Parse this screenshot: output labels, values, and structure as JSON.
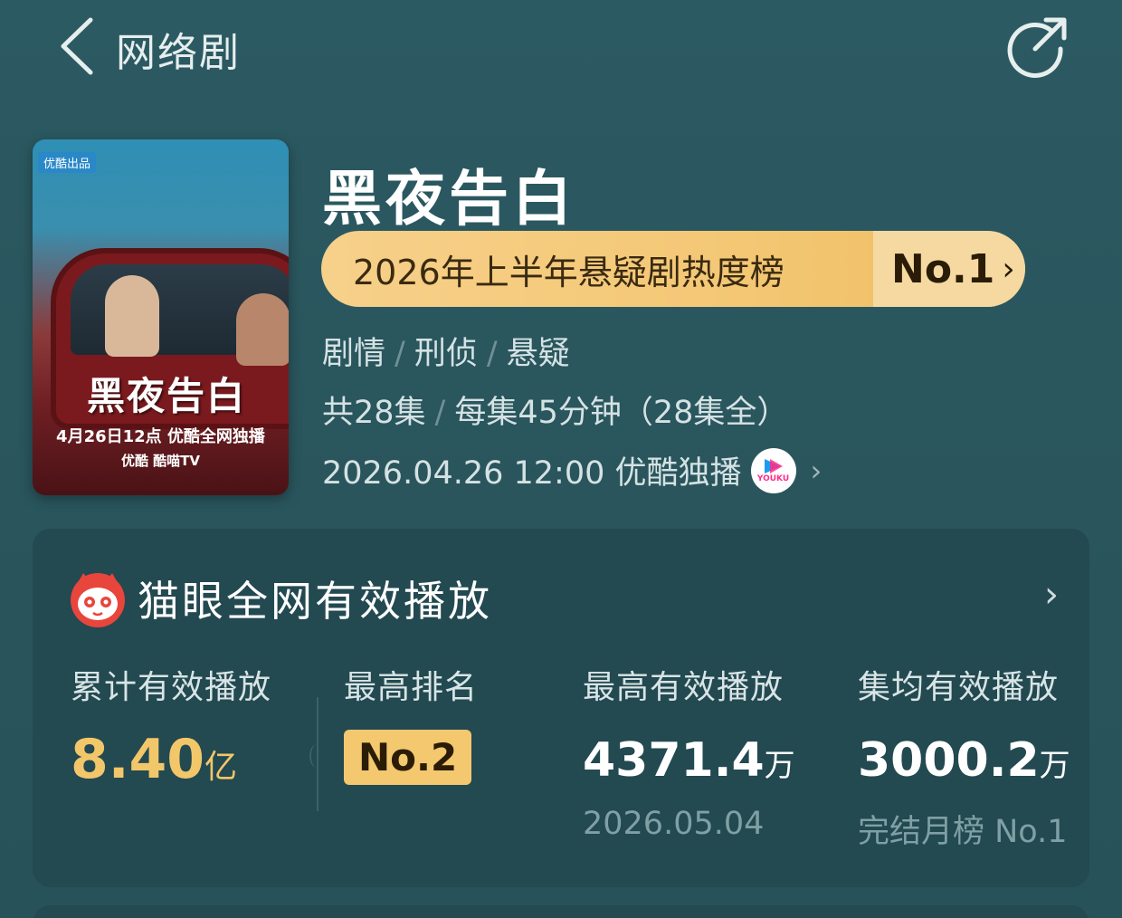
{
  "header": {
    "title": "网络剧"
  },
  "poster": {
    "badge": "优酷出品",
    "calligraphy": "黑夜告白",
    "date_line": "4月26日12点 优酷全网独播",
    "platforms": "优酷  酷喵TV"
  },
  "show": {
    "title": "黑夜告白",
    "rank_label": "2026年上半年悬疑剧热度榜",
    "rank_value": "No.1",
    "tags": [
      "剧情",
      "刑侦",
      "悬疑"
    ],
    "episode_count": "共28集",
    "episode_info": "每集45分钟（28集全）",
    "release": "2026.04.26 12:00 优酷独播",
    "youku_logo_text": "YOUKU"
  },
  "maoyan": {
    "title": "猫眼全网有效播放",
    "stats": [
      {
        "label": "累计有效播放",
        "value": "8.40",
        "unit": "亿",
        "sub": ""
      },
      {
        "label": "最高排名",
        "value": "No.2",
        "unit": "",
        "sub": ""
      },
      {
        "label": "最高有效播放",
        "value": "4371.4",
        "unit": "万",
        "sub": "2026.05.04"
      },
      {
        "label": "集均有效播放",
        "value": "3000.2",
        "unit": "万",
        "sub": "完结月榜 No.1"
      }
    ]
  },
  "colors": {
    "background": "#2c5a62",
    "card": "#234951",
    "gold": "#f2c76a",
    "pill": "#f3c774"
  },
  "icons": [
    "back-chevron-icon",
    "share-icon",
    "youku-icon",
    "maoyan-cat-icon",
    "chevron-right-icon"
  ]
}
